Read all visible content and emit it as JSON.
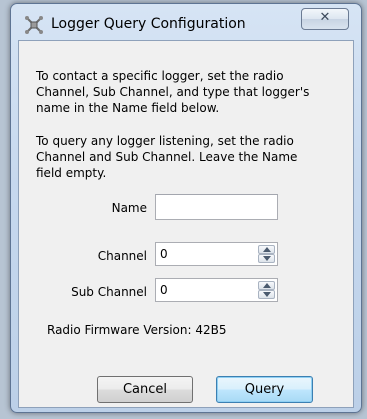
{
  "window": {
    "title": "Logger Query Configuration",
    "close_glyph": "✕",
    "app_icon": "logger-app-icon"
  },
  "instructions": {
    "specific": "To contact a specific logger, set the radio\nChannel, Sub Channel, and type that logger's\nname in the Name field below.",
    "any": "To query any logger listening, set the radio\nChannel and Sub Channel. Leave the Name\nfield empty."
  },
  "form": {
    "name_label": "Name",
    "name_value": "",
    "channel_label": "Channel",
    "channel_value": "0",
    "subchannel_label": "Sub Channel",
    "subchannel_value": "0"
  },
  "firmware": {
    "text": "Radio Firmware Version: 42B5"
  },
  "buttons": {
    "cancel": "Cancel",
    "query": "Query"
  },
  "colors": {
    "frame_accent": "#c6d8ee",
    "default_button": "#bee6fd",
    "client_bg": "#f0f0f0"
  }
}
